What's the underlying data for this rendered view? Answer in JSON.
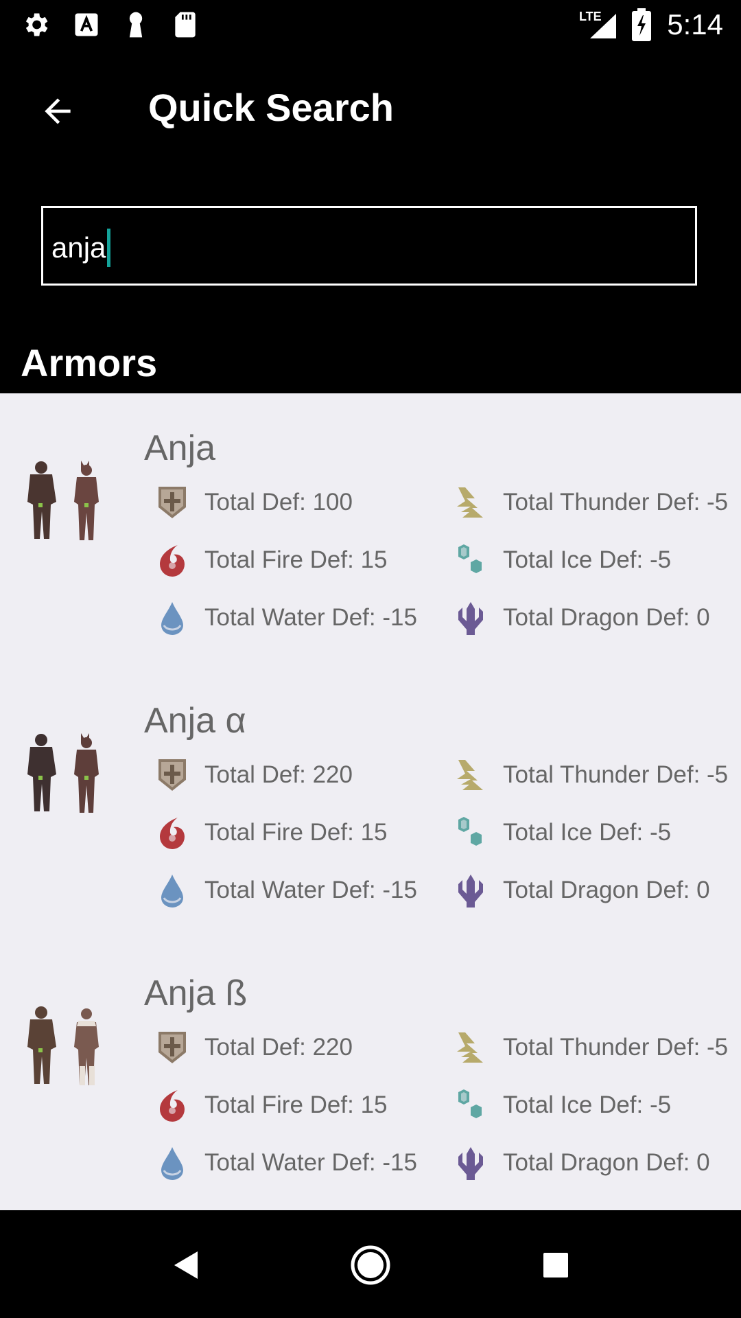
{
  "status_bar": {
    "time": "5:14",
    "left_icons": [
      "settings-icon",
      "font-icon",
      "keyhole-icon",
      "sd-card-icon"
    ],
    "right_icons": [
      "lte-signal-icon",
      "battery-charging-icon"
    ],
    "network_label": "LTE"
  },
  "toolbar": {
    "title": "Quick Search",
    "back_icon": "arrow-back-icon"
  },
  "search": {
    "value": "anja"
  },
  "section": {
    "title": "Armors"
  },
  "armors": [
    {
      "name": "Anja",
      "stats": {
        "def": "Total Def: 100",
        "fire": "Total Fire Def: 15",
        "water": "Total Water Def: -15",
        "thunder": "Total Thunder Def: -5",
        "ice": "Total Ice Def: -5",
        "dragon": "Total Dragon Def: 0"
      }
    },
    {
      "name": "Anja α",
      "stats": {
        "def": "Total Def: 220",
        "fire": "Total Fire Def: 15",
        "water": "Total Water Def: -15",
        "thunder": "Total Thunder Def: -5",
        "ice": "Total Ice Def: -5",
        "dragon": "Total Dragon Def: 0"
      }
    },
    {
      "name": "Anja ß",
      "stats": {
        "def": "Total Def: 220",
        "fire": "Total Fire Def: 15",
        "water": "Total Water Def: -15",
        "thunder": "Total Thunder Def: -5",
        "ice": "Total Ice Def: -5",
        "dragon": "Total Dragon Def: 0"
      }
    }
  ],
  "colors": {
    "background": "#000000",
    "list_background": "#efeef3",
    "text_secondary": "#666666",
    "caret": "#14a49b",
    "defense": "#8c7a68",
    "fire": "#b4393d",
    "water": "#6b93c0",
    "thunder": "#b7aa6b",
    "ice": "#5fa7a3",
    "dragon": "#6b5a94"
  },
  "nav_bar": {
    "back_icon": "nav-back-icon",
    "home_icon": "nav-home-icon",
    "recents_icon": "nav-recents-icon"
  }
}
